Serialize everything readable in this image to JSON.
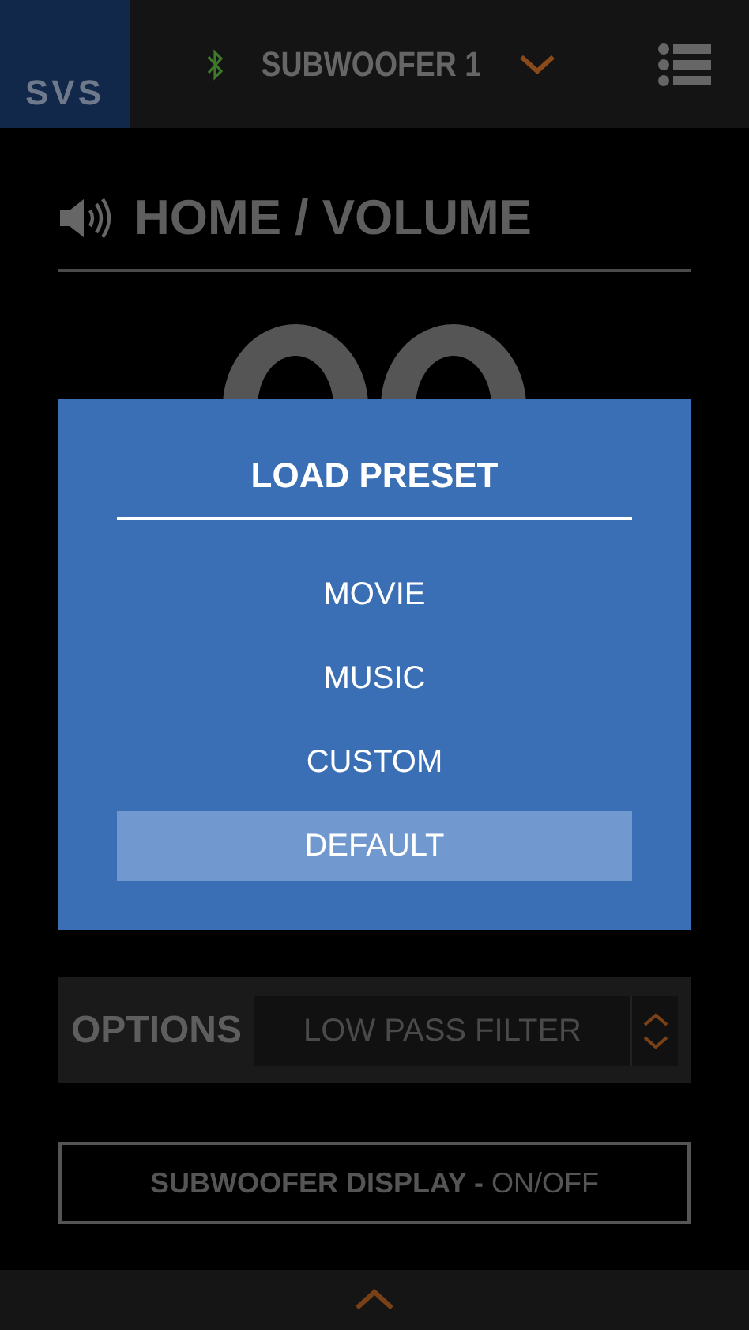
{
  "header": {
    "logo": "SVS",
    "device": "SUBWOOFER 1"
  },
  "section": {
    "title": "HOME / VOLUME"
  },
  "dialog": {
    "title": "LOAD PRESET",
    "presets": [
      {
        "label": "MOVIE",
        "selected": false
      },
      {
        "label": "MUSIC",
        "selected": false
      },
      {
        "label": "CUSTOM",
        "selected": false
      },
      {
        "label": "DEFAULT",
        "selected": true
      }
    ]
  },
  "options": {
    "label": "OPTIONS",
    "value": "LOW PASS FILTER"
  },
  "display_button": {
    "label": "SUBWOOFER DISPLAY -",
    "state": "ON/OFF"
  }
}
